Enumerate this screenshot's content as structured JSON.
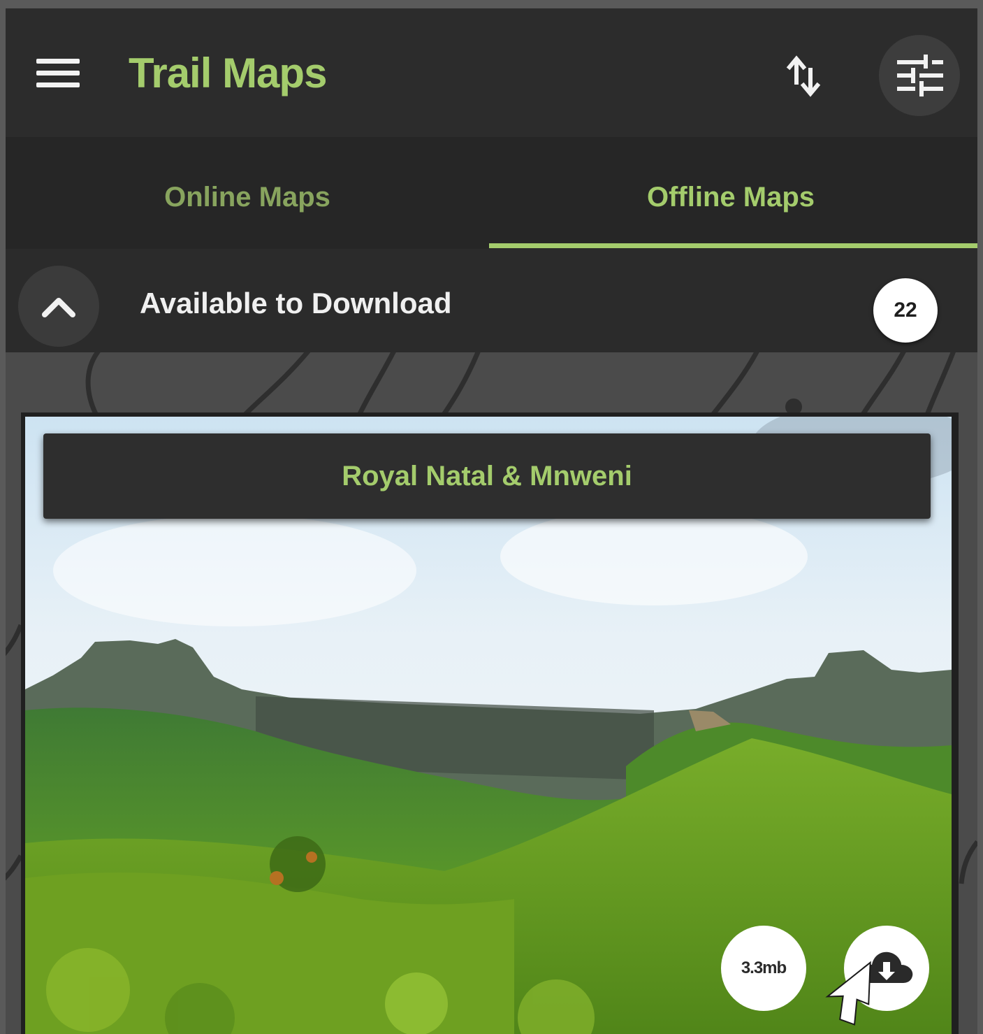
{
  "app": {
    "title": "Trail Maps",
    "accent_color": "#a4cc6c"
  },
  "header": {
    "menu_icon": "hamburger-menu-icon",
    "sort_icon": "sort-arrows-icon",
    "filter_icon": "tune-sliders-icon"
  },
  "tabs": [
    {
      "label": "Online Maps",
      "active": false
    },
    {
      "label": "Offline Maps",
      "active": true
    }
  ],
  "section": {
    "title": "Available to Download",
    "count": "22",
    "toggle_icon": "chevron-up-icon"
  },
  "maps": [
    {
      "name": "Royal Natal & Mnweni",
      "size": "3.3mb",
      "download_icon": "cloud-download-icon"
    }
  ]
}
